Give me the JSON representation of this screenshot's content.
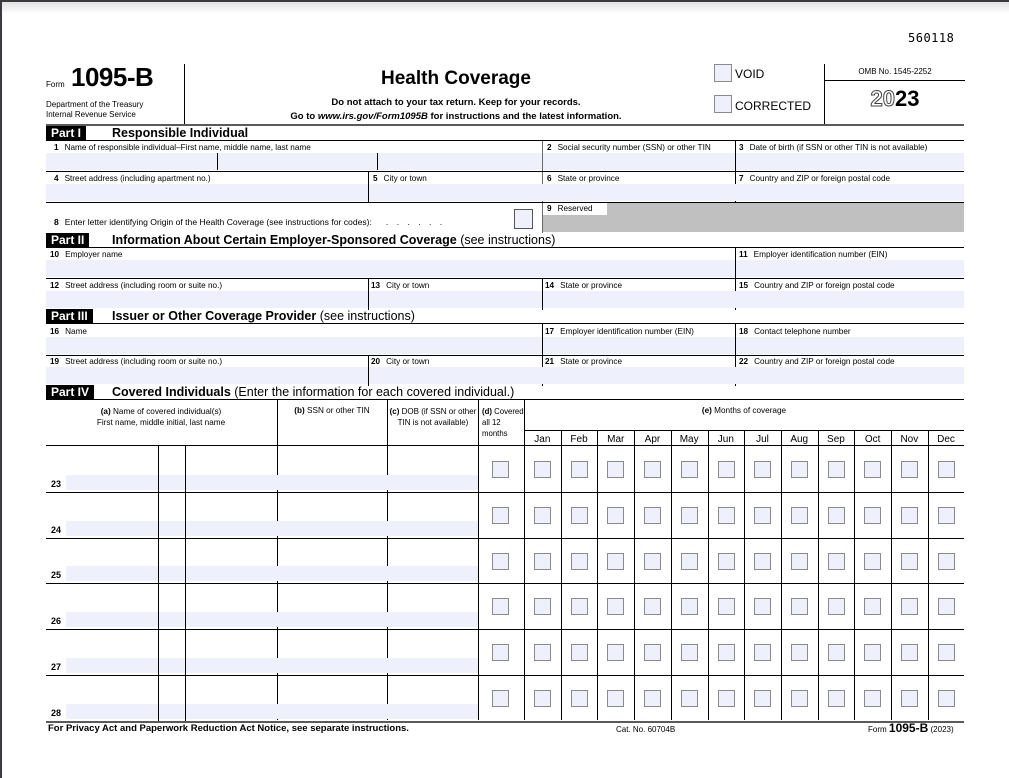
{
  "form_id_code": "560118",
  "header": {
    "form_word": "Form",
    "form_number": "1095-B",
    "dept_line1": "Department of the Treasury",
    "dept_line2": "Internal Revenue Service",
    "title": "Health Coverage",
    "subtitle1": "Do not attach to your tax return. Keep for your records.",
    "subtitle2_pre": "Go to ",
    "subtitle2_link": "www.irs.gov/Form1095B",
    "subtitle2_post": " for instructions and the latest information.",
    "void_label": "VOID",
    "corrected_label": "CORRECTED",
    "omb": "OMB No. 1545-2252",
    "year_outline": "20",
    "year_bold": "23"
  },
  "part1": {
    "tag": "Part I",
    "title": "Responsible Individual",
    "fields": {
      "f1": {
        "num": "1",
        "label": "Name of responsible individual–First name, middle name, last name",
        "value": ""
      },
      "f2": {
        "num": "2",
        "label": "Social security number (SSN) or other TIN",
        "value": ""
      },
      "f3": {
        "num": "3",
        "label": "Date of birth (if SSN or other TIN is not available)",
        "value": ""
      },
      "f4": {
        "num": "4",
        "label": "Street address (including apartment no.)",
        "value": ""
      },
      "f5": {
        "num": "5",
        "label": "City or town",
        "value": ""
      },
      "f6": {
        "num": "6",
        "label": "State or province",
        "value": ""
      },
      "f7": {
        "num": "7",
        "label": "Country and ZIP or foreign postal code",
        "value": ""
      },
      "f8": {
        "num": "8",
        "label": "Enter letter identifying Origin of the Health Coverage (see instructions for codes):",
        "dots": ". . . . . .",
        "value": ""
      },
      "f9": {
        "num": "9",
        "label": "Reserved"
      }
    }
  },
  "part2": {
    "tag": "Part II",
    "title": "Information About Certain Employer-Sponsored Coverage",
    "title_suffix": " (see instructions)",
    "fields": {
      "f10": {
        "num": "10",
        "label": "Employer name",
        "value": ""
      },
      "f11": {
        "num": "11",
        "label": "Employer identification number (EIN)",
        "value": ""
      },
      "f12": {
        "num": "12",
        "label": "Street address (including room or suite no.)",
        "value": ""
      },
      "f13": {
        "num": "13",
        "label": "City or town",
        "value": ""
      },
      "f14": {
        "num": "14",
        "label": "State or province",
        "value": ""
      },
      "f15": {
        "num": "15",
        "label": "Country and ZIP or foreign postal code",
        "value": ""
      }
    }
  },
  "part3": {
    "tag": "Part III",
    "title": "Issuer or Other Coverage Provider",
    "title_suffix": " (see instructions)",
    "fields": {
      "f16": {
        "num": "16",
        "label": "Name",
        "value": ""
      },
      "f17": {
        "num": "17",
        "label": "Employer identification number (EIN)",
        "value": ""
      },
      "f18": {
        "num": "18",
        "label": "Contact telephone number",
        "value": ""
      },
      "f19": {
        "num": "19",
        "label": "Street address (including room or suite no.)",
        "value": ""
      },
      "f20": {
        "num": "20",
        "label": "City or town",
        "value": ""
      },
      "f21": {
        "num": "21",
        "label": "State or province",
        "value": ""
      },
      "f22": {
        "num": "22",
        "label": "Country and ZIP or foreign postal code",
        "value": ""
      }
    }
  },
  "part4": {
    "tag": "Part IV",
    "title": "Covered Individuals",
    "title_suffix": " (Enter the information for each covered individual.)",
    "col_a_letter": "(a)",
    "col_a_line1": " Name of covered individual(s)",
    "col_a_line2": "First name, middle initial, last name",
    "col_b_letter": "(b)",
    "col_b": " SSN or other TIN",
    "col_c_letter": "(c)",
    "col_c_line1": " DOB (if SSN or other",
    "col_c_line2": "TIN is not available)",
    "col_d_letter": "(d)",
    "col_d_line1": " Covered",
    "col_d_line2": "all 12 months",
    "col_e_letter": "(e)",
    "col_e": " Months of coverage",
    "months": [
      "Jan",
      "Feb",
      "Mar",
      "Apr",
      "May",
      "Jun",
      "Jul",
      "Aug",
      "Sep",
      "Oct",
      "Nov",
      "Dec"
    ],
    "rows": [
      {
        "num": "23"
      },
      {
        "num": "24"
      },
      {
        "num": "25"
      },
      {
        "num": "26"
      },
      {
        "num": "27"
      },
      {
        "num": "28"
      }
    ]
  },
  "footer": {
    "privacy": "For Privacy Act and Paperwork Reduction Act Notice, see separate instructions.",
    "cat_no": "Cat. No. 60704B",
    "form_word": "Form",
    "form_number": "1095-B",
    "form_year": "(2023)"
  }
}
